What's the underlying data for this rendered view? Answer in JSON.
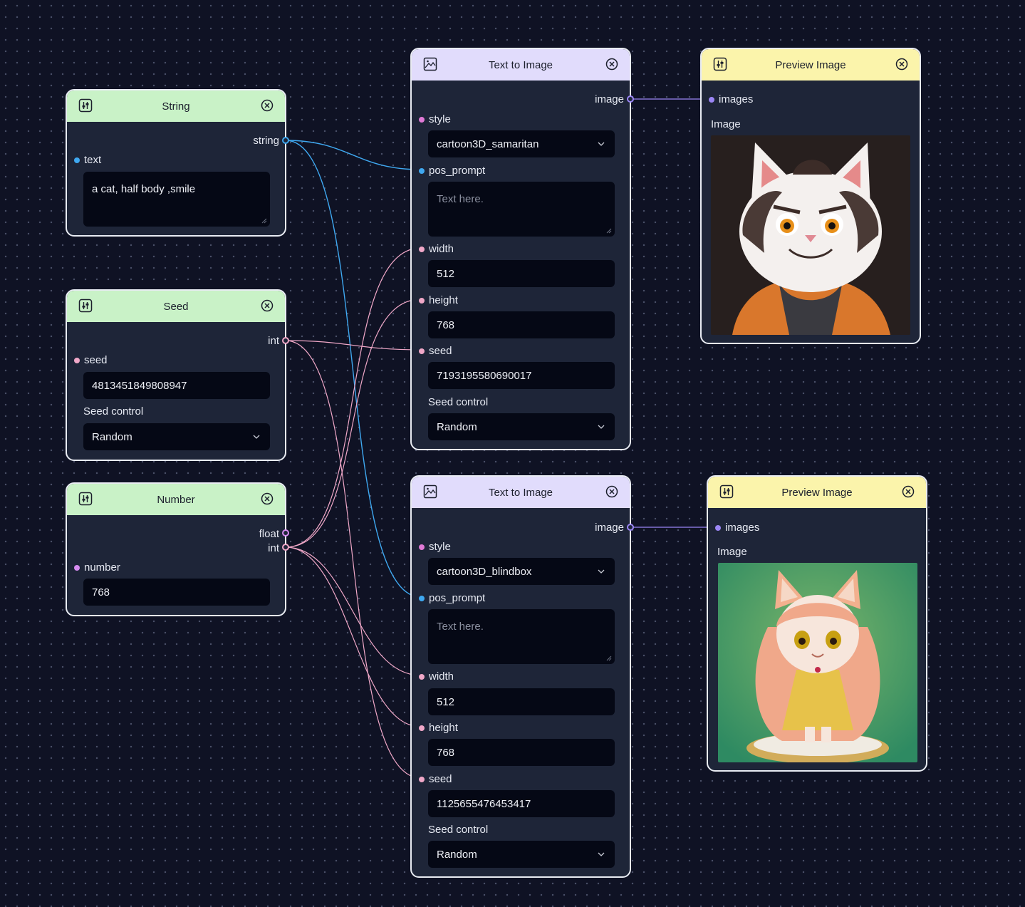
{
  "colors": {
    "string_port": "#3fa8f0",
    "int_port": "#f0a8c8",
    "float_port": "#d68cf0",
    "image_port": "#9b86f5"
  },
  "string_node": {
    "title": "String",
    "output_label": "string",
    "input_label": "text",
    "text_value": "a cat, half body ,smile"
  },
  "seed_node": {
    "title": "Seed",
    "output_label": "int",
    "input_label": "seed",
    "seed_value": "4813451849808947",
    "seed_control_label": "Seed control",
    "seed_control_value": "Random"
  },
  "number_node": {
    "title": "Number",
    "output_float": "float",
    "output_int": "int",
    "input_label": "number",
    "number_value": "768"
  },
  "t2i_1": {
    "title": "Text to Image",
    "output_label": "image",
    "style_label": "style",
    "style_value": "cartoon3D_samaritan",
    "pos_prompt_label": "pos_prompt",
    "pos_prompt_placeholder": "Text here.",
    "width_label": "width",
    "width_value": "512",
    "height_label": "height",
    "height_value": "768",
    "seed_label": "seed",
    "seed_value": "7193195580690017",
    "seed_control_label": "Seed control",
    "seed_control_value": "Random"
  },
  "t2i_2": {
    "title": "Text to Image",
    "output_label": "image",
    "style_label": "style",
    "style_value": "cartoon3D_blindbox",
    "pos_prompt_label": "pos_prompt",
    "pos_prompt_placeholder": "Text here.",
    "width_label": "width",
    "width_value": "512",
    "height_label": "height",
    "height_value": "768",
    "seed_label": "seed",
    "seed_value": "1125655476453417",
    "seed_control_label": "Seed control",
    "seed_control_value": "Random"
  },
  "preview_1": {
    "title": "Preview Image",
    "input_label": "images",
    "image_label": "Image"
  },
  "preview_2": {
    "title": "Preview Image",
    "input_label": "images",
    "image_label": "Image"
  }
}
